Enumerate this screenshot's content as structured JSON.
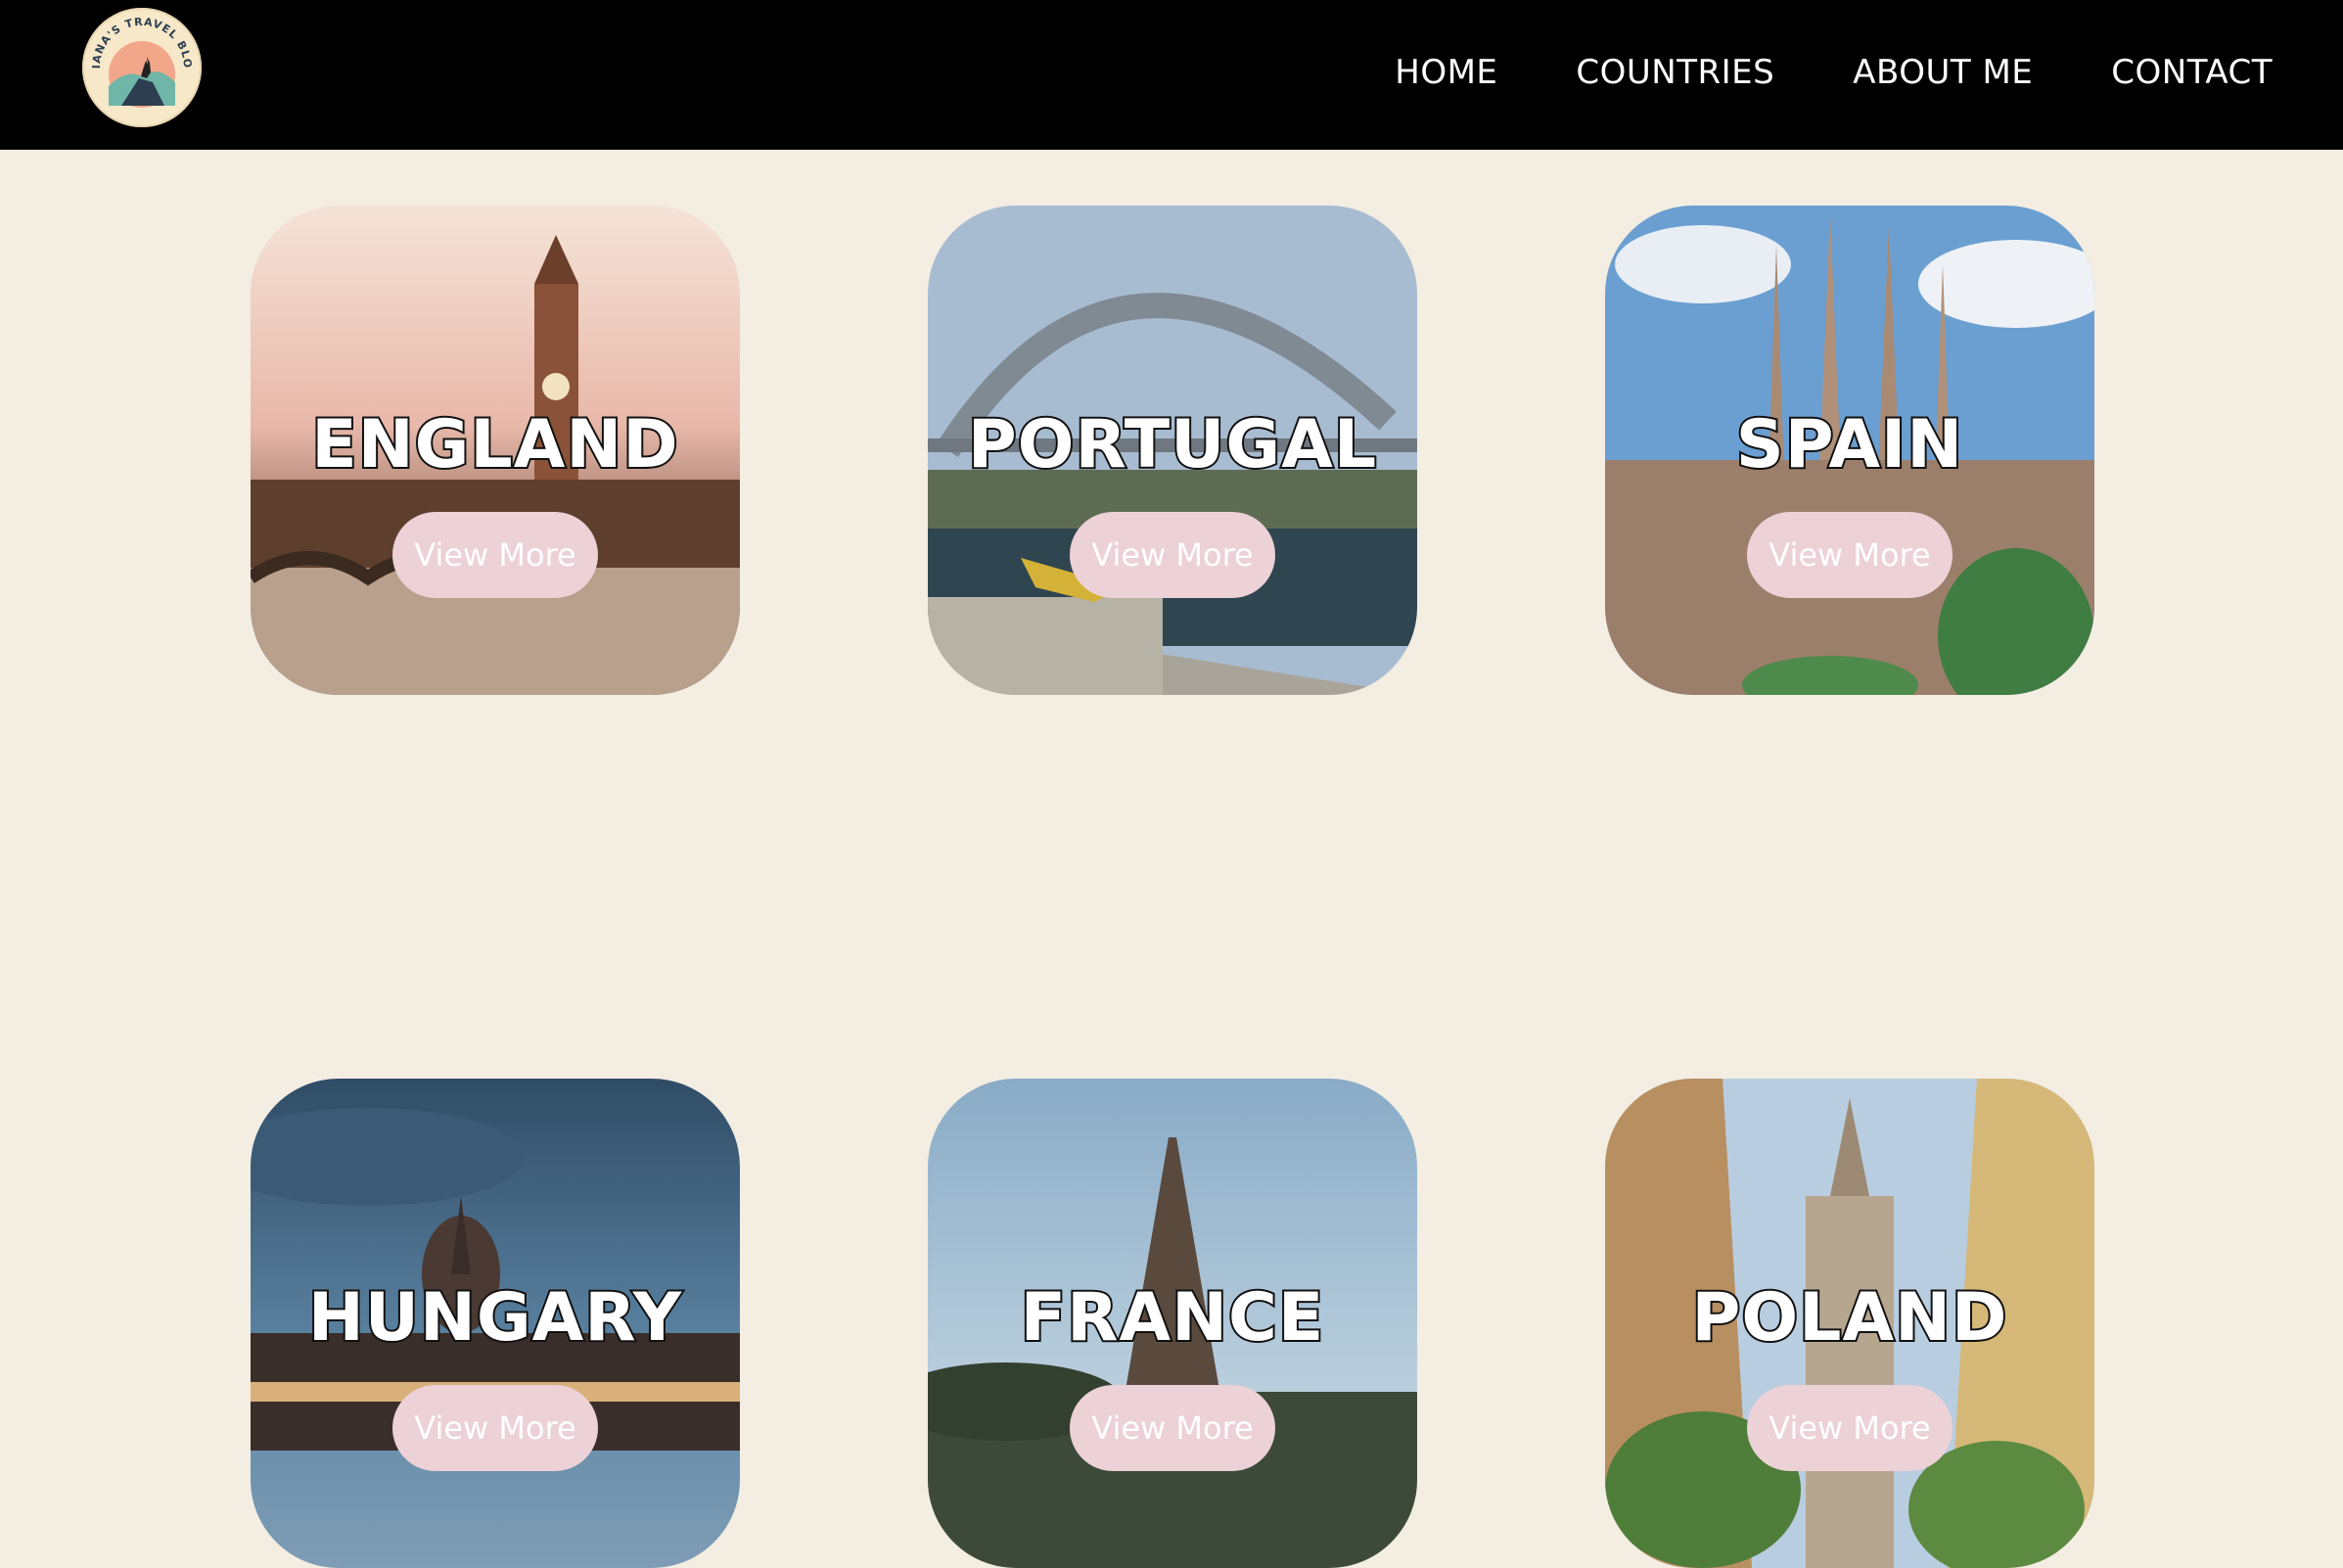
{
  "navbar": {
    "logo_text": "DIANA'S TRAVEL BLOG",
    "links": [
      "HOME",
      "COUNTRIES",
      "ABOUT ME",
      "CONTACT"
    ]
  },
  "countries": [
    {
      "name": "ENGLAND",
      "button": "View More"
    },
    {
      "name": "PORTUGAL",
      "button": "View More"
    },
    {
      "name": "SPAIN",
      "button": "View More"
    },
    {
      "name": "HUNGARY",
      "button": "View More"
    },
    {
      "name": "FRANCE",
      "button": "View More"
    },
    {
      "name": "POLAND",
      "button": "View More"
    }
  ],
  "colors": {
    "background": "#f3ede2",
    "navbar": "#000000",
    "button": "#ecd1d7"
  }
}
